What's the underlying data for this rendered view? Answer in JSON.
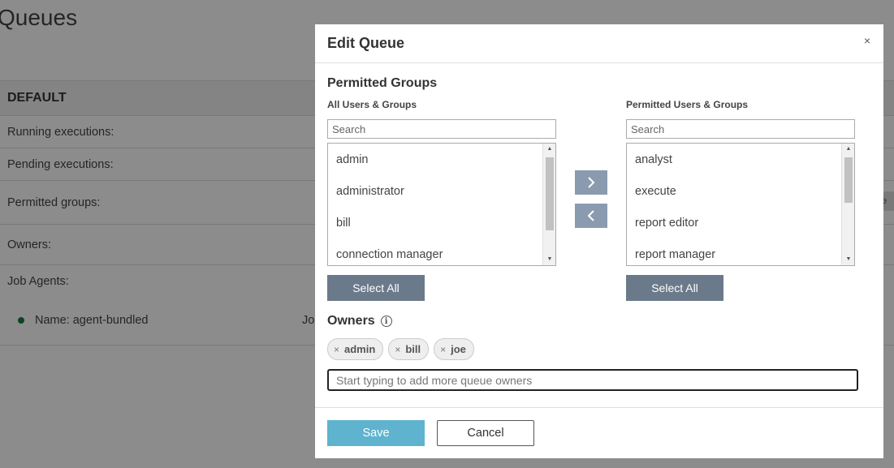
{
  "page": {
    "title": "Queues",
    "queue": {
      "name": "DEFAULT",
      "rows": {
        "running": "Running executions:",
        "pending": "Pending executions:",
        "permitted": "Permitted groups:",
        "owners": "Owners:",
        "job_agents": "Job Agents:"
      },
      "agent": {
        "name": "Name: agent-bundled",
        "job_fragment": "Jol"
      },
      "chip_fragment": "e"
    }
  },
  "modal": {
    "title": "Edit Queue",
    "close_label": "×",
    "permitted_groups": {
      "title": "Permitted Groups",
      "all_label": "All Users & Groups",
      "permitted_label": "Permitted Users & Groups",
      "search_placeholder": "Search",
      "all_items": [
        "admin",
        "administrator",
        "bill",
        "connection manager"
      ],
      "permitted_items": [
        "analyst",
        "execute",
        "report editor",
        "report manager"
      ],
      "select_all_label": "Select All"
    },
    "owners": {
      "title": "Owners",
      "info_icon": "i",
      "chips": [
        "admin",
        "bill",
        "joe"
      ],
      "chip_remove": "×",
      "input_placeholder": "Start typing to add more queue owners"
    },
    "footer": {
      "save_label": "Save",
      "cancel_label": "Cancel"
    }
  },
  "colors": {
    "arrow_button": "#8a9bb0",
    "select_all_button": "#6b7a8a",
    "save_button": "#5fb3cf",
    "agent_status": "#1b7a3c"
  },
  "icons": {
    "move_right": "chevron-right-icon",
    "move_left": "chevron-left-icon",
    "info": "info-icon",
    "close": "close-icon"
  }
}
